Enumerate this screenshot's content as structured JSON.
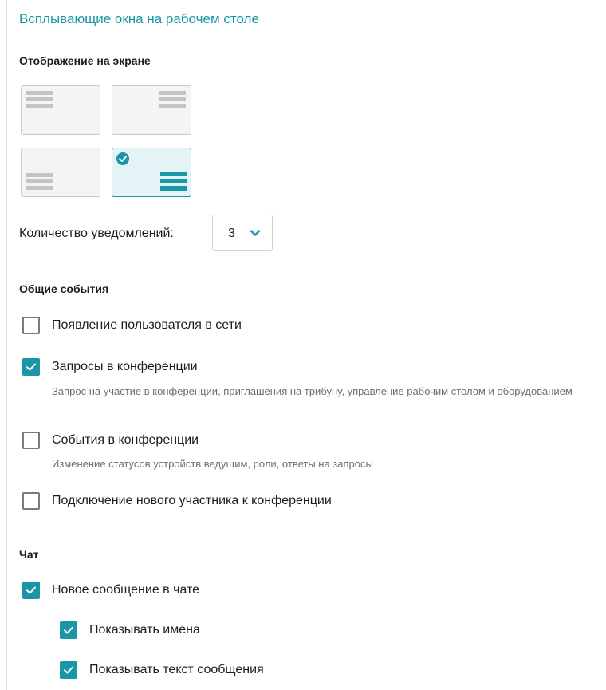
{
  "title": "Всплывающие окна на рабочем столе",
  "display": {
    "heading": "Отображение на экране",
    "positions": [
      {
        "id": "top-left",
        "selected": false
      },
      {
        "id": "top-right",
        "selected": false
      },
      {
        "id": "bottom-left",
        "selected": false
      },
      {
        "id": "bottom-right",
        "selected": true
      }
    ]
  },
  "count": {
    "label": "Количество уведомлений:",
    "value": "3"
  },
  "general": {
    "heading": "Общие события",
    "items": [
      {
        "label": "Появление пользователя в сети",
        "checked": false,
        "description": ""
      },
      {
        "label": "Запросы в конференции",
        "checked": true,
        "description": "Запрос на участие в конференции, приглашения на трибуну, управление рабочим столом и оборудованием"
      },
      {
        "label": "События в конференции",
        "checked": false,
        "description": "Изменение статусов устройств ведущим, роли, ответы на запросы"
      },
      {
        "label": "Подключение нового участника к конференции",
        "checked": false,
        "description": ""
      }
    ]
  },
  "chat": {
    "heading": "Чат",
    "items": [
      {
        "label": "Новое сообщение в чате",
        "checked": true
      },
      {
        "label": "Показывать имена",
        "checked": true
      },
      {
        "label": "Показывать текст сообщения",
        "checked": true
      }
    ]
  },
  "colors": {
    "accent": "#1b95a8",
    "tile_bg": "#f4f4f4",
    "tile_selected_bg": "#e3f3f6"
  }
}
